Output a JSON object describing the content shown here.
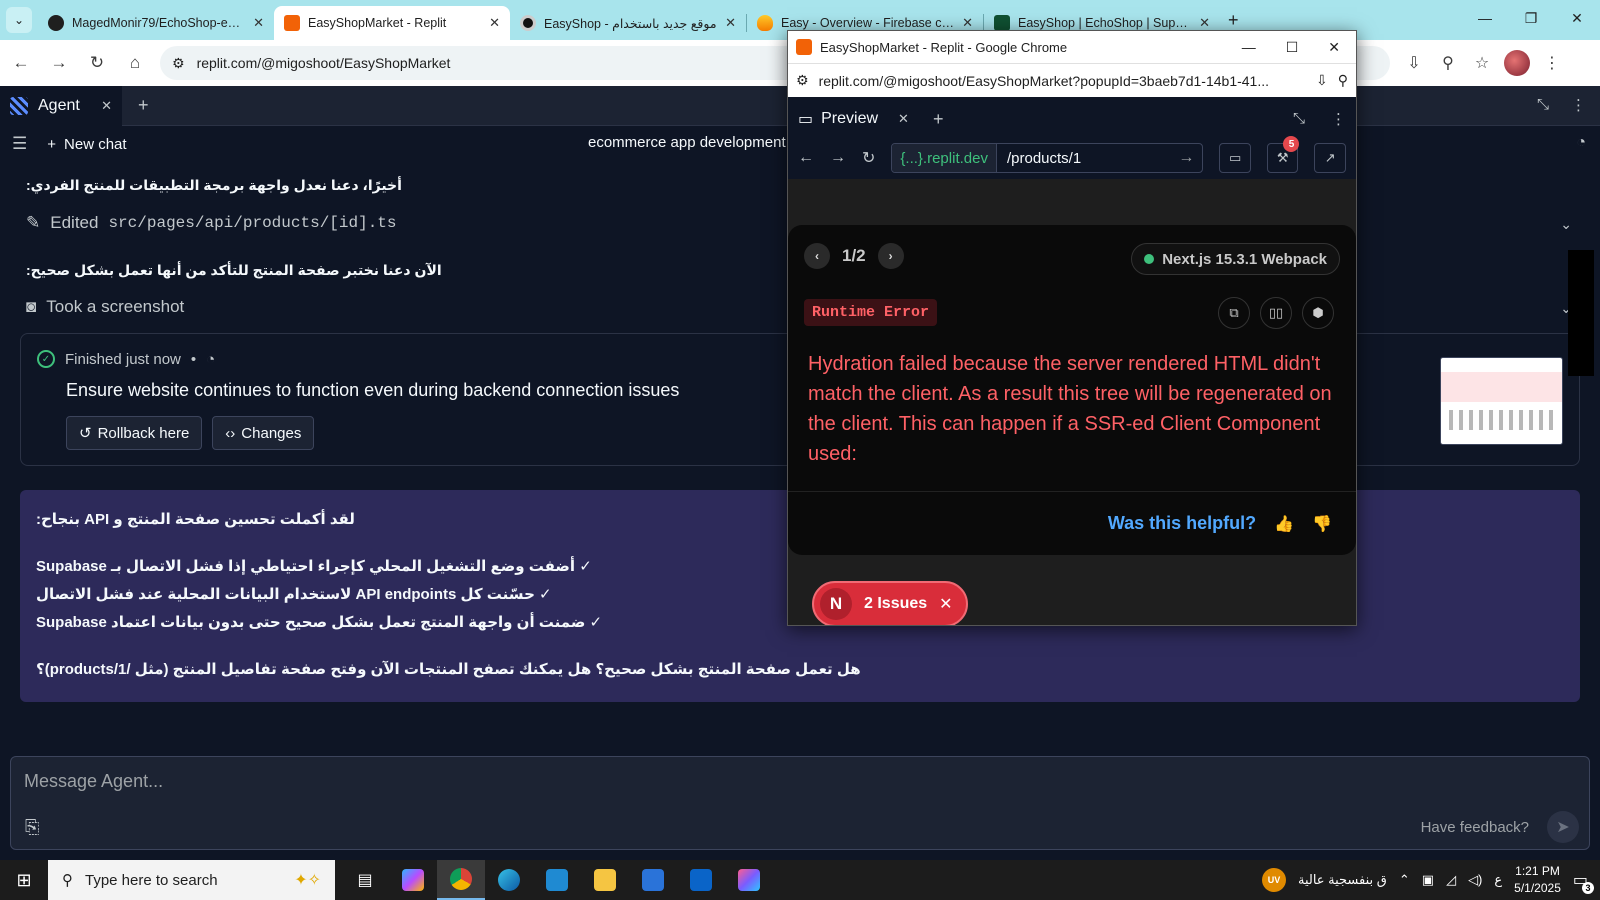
{
  "browser": {
    "tabs": [
      {
        "title": "MagedMonir79/EchoShop-eg: E",
        "active": false
      },
      {
        "title": "EasyShopMarket - Replit",
        "active": true
      },
      {
        "title": "EasyShop - موقع جديد باستخدام",
        "active": false
      },
      {
        "title": "Easy - Overview - Firebase cons",
        "active": false
      },
      {
        "title": "EasyShop | EchoShop | Supabas",
        "active": false
      }
    ],
    "url": "replit.com/@migoshoot/EasyShopMarket"
  },
  "agent": {
    "tab_label": "Agent",
    "new_chat": "New chat",
    "chat_title": "ecommerce app development",
    "msg1": "أخيرًا، دعنا نعدل واجهة برمجة التطبيقات للمنتج الفردي:",
    "edited_label": "Edited",
    "edited_path": "src/pages/api/products/[id].ts",
    "msg2": "الآن دعنا نختبر صفحة المنتج للتأكد من أنها تعمل بشكل صحيح:",
    "screenshot_label": "Took a screenshot",
    "checkpoint": {
      "status": "Finished just now",
      "bullet": "•",
      "description": "Ensure website continues to function even during backend connection issues",
      "rollback": "Rollback here",
      "changes": "Changes"
    },
    "reply": {
      "line1": "لقد أكملت تحسين صفحة المنتج و API بنجاح:",
      "line2": "✓ أضفت وضع التشغيل المحلي كإجراء احتياطي إذا فشل الاتصال بـ Supabase",
      "line3": "✓ حسّنت كل API endpoints لاستخدام البيانات المحلية عند فشل الاتصال",
      "line4": "✓ ضمنت أن واجهة المنتج تعمل بشكل صحيح حتى بدون بيانات اعتماد Supabase",
      "line5": "هل تعمل صفحة المنتج بشكل صحيح؟ هل يمكنك تصفح المنتجات الآن وفتح صفحة تفاصيل المنتج (مثل /products/1)؟"
    },
    "composer": {
      "placeholder": "Message Agent...",
      "feedback": "Have feedback?"
    }
  },
  "popup": {
    "window_title": "EasyShopMarket - Replit - Google Chrome",
    "url": "replit.com/@migoshoot/EasyShopMarket?popupId=3baeb7d1-14b1-41...",
    "preview_label": "Preview",
    "domain": "{...}.replit.dev",
    "path": "/products/1",
    "devtools_badge": "5",
    "error": {
      "pager": "1/2",
      "framework": "Next.js 15.3.1 Webpack",
      "label": "Runtime Error",
      "message": "Hydration failed because the server rendered HTML didn't match the client. As a result this tree will be regenerated on the client. This can happen if a SSR-ed Client Component used:",
      "helpful": "Was this helpful?",
      "issues_logo": "N",
      "issues": "2 Issues"
    }
  },
  "taskbar": {
    "search_placeholder": "Type here to search",
    "weather_badge": "UV",
    "weather_text": "ق بنفسجية عالية",
    "lang": "ع",
    "time": "1:21 PM",
    "date": "5/1/2025",
    "notif_count": "3"
  }
}
